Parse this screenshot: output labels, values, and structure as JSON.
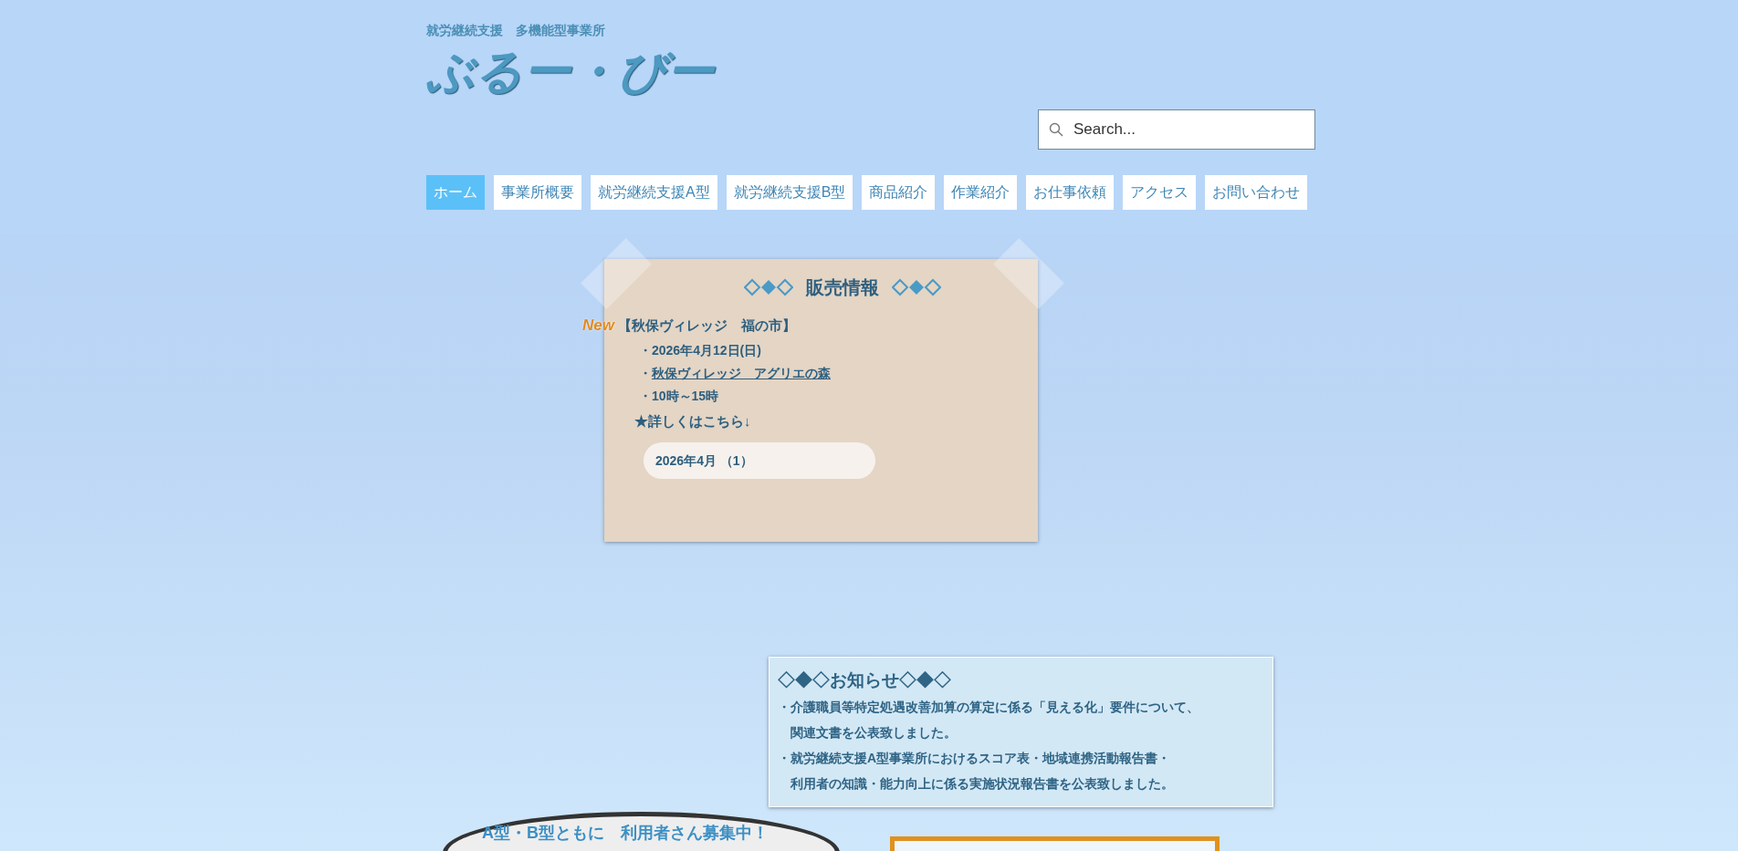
{
  "header": {
    "subtitle": "就労継続支援　多機能型事業所",
    "title": "ぶるー・びー"
  },
  "search": {
    "placeholder": "Search..."
  },
  "nav": [
    {
      "label": "ホーム",
      "selected": true
    },
    {
      "label": "事業所概要",
      "selected": false
    },
    {
      "label": "就労継続支援A型",
      "selected": false
    },
    {
      "label": "就労継続支援B型",
      "selected": false
    },
    {
      "label": "商品紹介",
      "selected": false
    },
    {
      "label": "作業紹介",
      "selected": false
    },
    {
      "label": "お仕事依頼",
      "selected": false
    },
    {
      "label": "アクセス",
      "selected": false
    },
    {
      "label": "お問い合わせ",
      "selected": false
    }
  ],
  "sales": {
    "heading": "販売情報",
    "badge": "New",
    "event": "【秋保ヴィレッジ　福の市】",
    "details": [
      {
        "kind": "text",
        "text": "・2026年4月12日(日)"
      },
      {
        "kind": "link",
        "prefix": "・",
        "text": "秋保ヴィレッジ　アグリエの森"
      },
      {
        "kind": "text",
        "text": "・10時～15時"
      }
    ],
    "more": "★詳しくはこちら↓",
    "archive": "2026年4月 （1）"
  },
  "notice": {
    "heading": "◇◆◇お知らせ◇◆◇",
    "items": [
      {
        "lines": [
          "・介護職員等特定処遇改善加算の算定に係る「見える化」要件について、",
          "関連文書を公表致しました。"
        ]
      },
      {
        "lines": [
          "・就労継続支援A型事業所におけるスコア表・地域連携活動報告書・",
          "利用者の知識・能力向上に係る実施状況報告書を公表致しました。"
        ]
      }
    ]
  },
  "recruit": {
    "text": "A型・B型ともに　利用者さん募集中！"
  }
}
